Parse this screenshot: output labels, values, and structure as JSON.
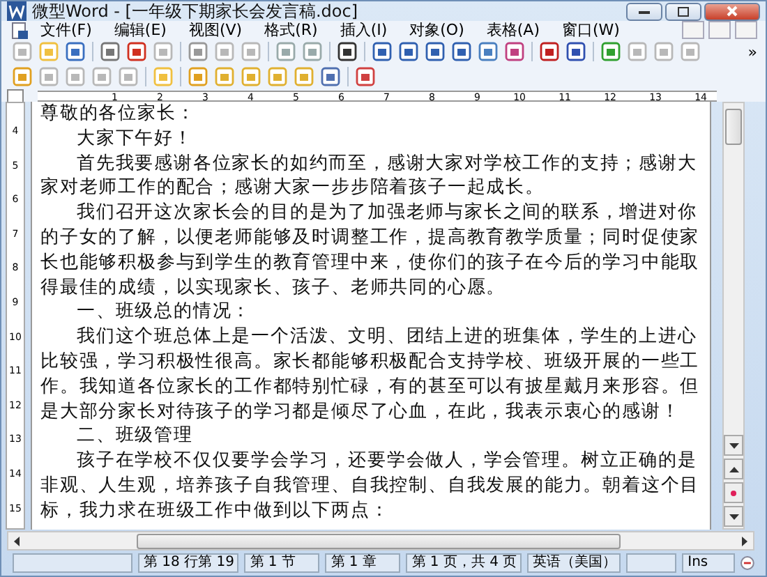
{
  "window": {
    "title": "微型Word - [一年级下期家长会发言稿.doc]"
  },
  "menu": [
    "文件(F)",
    "编辑(E)",
    "视图(V)",
    "格式(R)",
    "插入(I)",
    "对象(O)",
    "表格(A)",
    "窗口(W)"
  ],
  "toolbar": {
    "overflow": "»"
  },
  "ruler": {
    "marks": [
      "1",
      "2",
      "3",
      "4",
      "5",
      "6",
      "7",
      "8",
      "9",
      "10",
      "11",
      "12",
      "13",
      "14"
    ]
  },
  "vertical_ruler": {
    "marks": [
      "4",
      "5",
      "6",
      "7",
      "8",
      "9",
      "10",
      "11",
      "12",
      "13",
      "14",
      "15"
    ]
  },
  "document": {
    "paragraphs": [
      {
        "kind": "plain",
        "text": "尊敬的各位家长："
      },
      {
        "kind": "indent",
        "text": "大家下午好！"
      },
      {
        "kind": "indent",
        "text": "首先我要感谢各位家长的如约而至，感谢大家对学校工作的支持；感谢大家对老师工作的配合；感谢大家一步步陪着孩子一起成长。"
      },
      {
        "kind": "indent",
        "text": "我们召开这次家长会的目的是为了加强老师与家长之间的联系，增进对你的子女的了解，以便老师能够及时调整工作，提高教育教学质量；同时促使家长也能够积极参与到学生的教育管理中来，使你们的孩子在今后的学习中能取得最佳的成绩，以实现家长、孩子、老师共同的心愿。"
      },
      {
        "kind": "indent",
        "text": "一、班级总的情况："
      },
      {
        "kind": "indent",
        "text": "我们这个班总体上是一个活泼、文明、团结上进的班集体，学生的上进心比较强，学习积极性很高。家长都能够积极配合支持学校、班级开展的一些工作。我知道各位家长的工作都特别忙碌，有的甚至可以有披星戴月来形容。但是大部分家长对待孩子的学习都是倾尽了心血，在此，我表示衷心的感谢！"
      },
      {
        "kind": "indent",
        "text": "二、班级管理"
      },
      {
        "kind": "indent",
        "text": "孩子在学校不仅仅要学会学习，还要学会做人，学会管理。树立正确的是非观、人生观，培养孩子自我管理、自我控制、自我发展的能力。朝着这个目标，我力求在班级工作中做到以下两点："
      }
    ]
  },
  "status_bar": [
    "第 18 行第 19",
    "第 1 节",
    "第 1 章",
    "第 1 页，共 4 页",
    "英语（美国）",
    "Ins"
  ]
}
